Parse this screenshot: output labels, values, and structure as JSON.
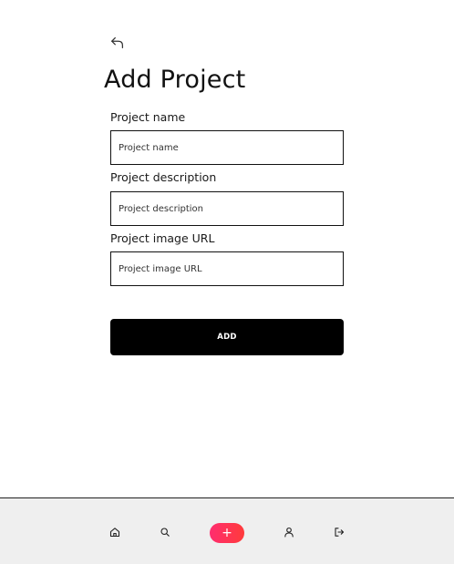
{
  "header": {
    "back_icon": "undo-arrow-icon",
    "title": "Add Project"
  },
  "form": {
    "fields": [
      {
        "label": "Project name",
        "placeholder": "Project name",
        "value": ""
      },
      {
        "label": "Project description",
        "placeholder": "Project description",
        "value": ""
      },
      {
        "label": "Project image URL",
        "placeholder": "Project image URL",
        "value": ""
      }
    ],
    "submit_label": "ADD"
  },
  "bottom_nav": {
    "items": [
      {
        "icon": "home-icon"
      },
      {
        "icon": "search-icon"
      },
      {
        "icon": "plus-icon",
        "label": "+"
      },
      {
        "icon": "user-icon"
      },
      {
        "icon": "logout-icon"
      }
    ],
    "accent_gradient": [
      "#ff2d6f",
      "#ff3b3b"
    ],
    "background": "#efefef"
  }
}
